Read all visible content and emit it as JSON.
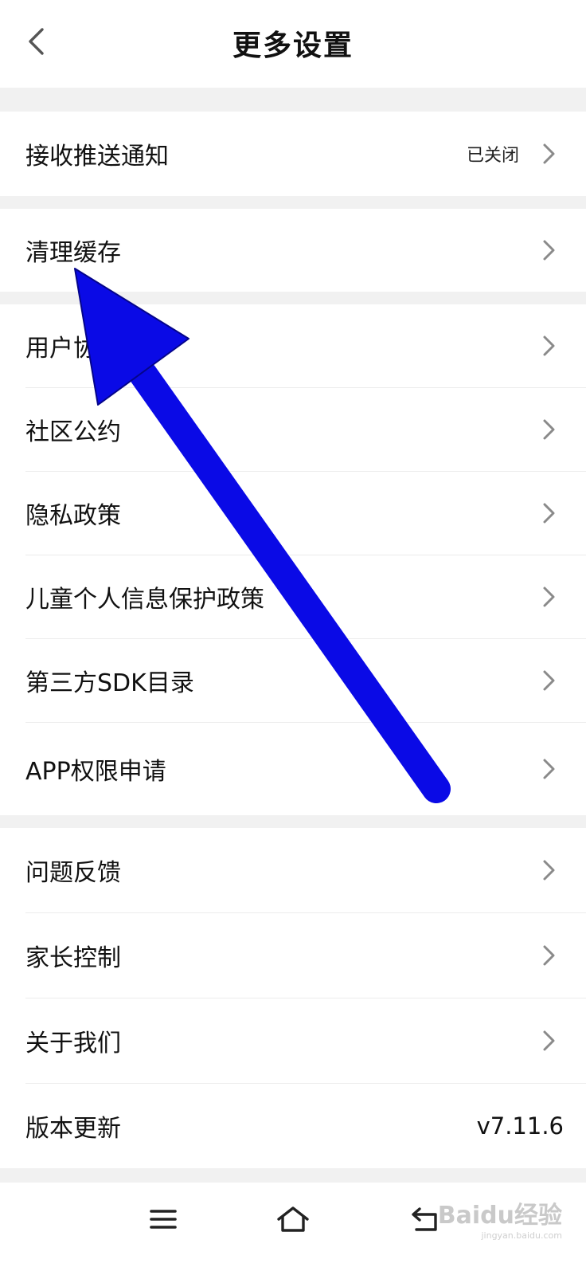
{
  "header": {
    "title": "更多设置",
    "back_icon": "chevron-left-icon"
  },
  "settings": {
    "push": {
      "label": "接收推送通知",
      "value": "已关闭"
    },
    "clear_cache": {
      "label": "清理缓存"
    },
    "user_agreement": {
      "label": "用户协议"
    },
    "community": {
      "label": "社区公约"
    },
    "privacy": {
      "label": "隐私政策"
    },
    "child_privacy": {
      "label": "儿童个人信息保护政策"
    },
    "sdk_list": {
      "label": "第三方SDK目录"
    },
    "app_permissions": {
      "label": "APP权限申请"
    },
    "feedback": {
      "label": "问题反馈"
    },
    "parental": {
      "label": "家长控制"
    },
    "about": {
      "label": "关于我们"
    },
    "version": {
      "label": "版本更新",
      "value": "v7.11.6"
    }
  },
  "nav": {
    "menu_icon": "menu-icon",
    "home_icon": "home-icon",
    "back_icon": "back-icon"
  },
  "watermark": {
    "brand": "Baidu经验",
    "domain": "jingyan.baidu.com"
  },
  "colors": {
    "page_bg": "#ffffff",
    "section_gap": "#f1f1f1",
    "arrow_fill": "#0a0ae6",
    "chevron": "#8a8a8a"
  }
}
